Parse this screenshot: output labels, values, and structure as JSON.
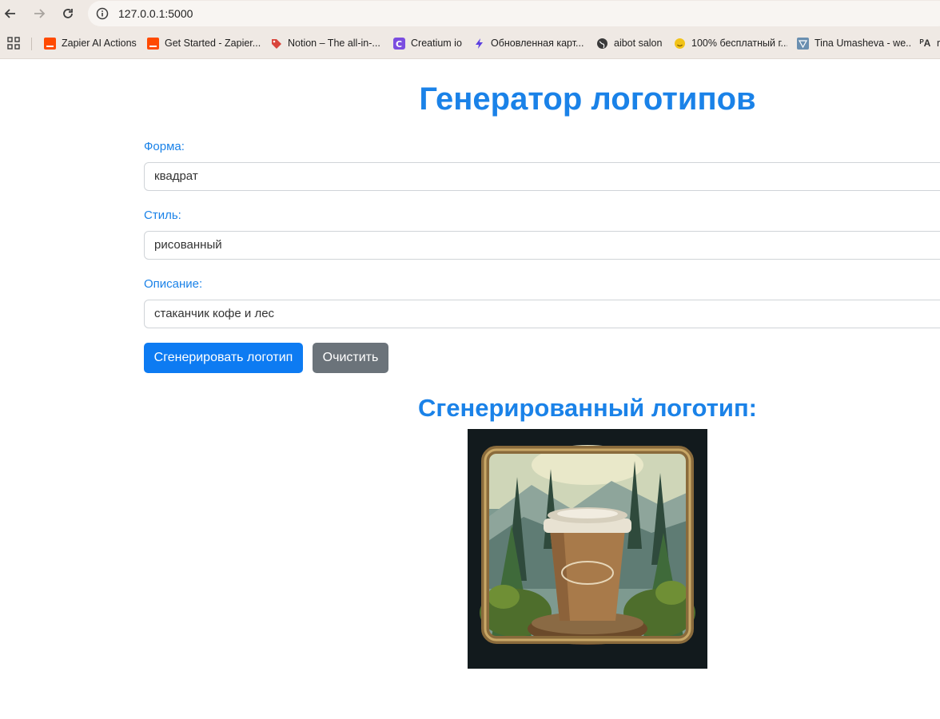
{
  "browser": {
    "url": "127.0.0.1:5000",
    "bookmarks": [
      {
        "label": "Zapier AI Actions",
        "icon": "zapier-icon",
        "color": "#ff4a00"
      },
      {
        "label": "Get Started - Zapier...",
        "icon": "zapier-icon",
        "color": "#ff4a00"
      },
      {
        "label": "Notion – The all-in-...",
        "icon": "tag-icon",
        "color": "#d9453b"
      },
      {
        "label": "Creatium io",
        "icon": "creatium-icon",
        "color": "#7b4de0"
      },
      {
        "label": "Обновленная карт...",
        "icon": "bolt-icon",
        "color": "#5b3fe0"
      },
      {
        "label": "aibot salon",
        "icon": "globe-icon",
        "color": "#3a3a3a"
      },
      {
        "label": "100% бесплатный г...",
        "icon": "smile-icon",
        "color": "#f2c318"
      },
      {
        "label": "Tina Umasheva - we...",
        "icon": "triangle-icon",
        "color": "#6a8fb0"
      },
      {
        "label": "r",
        "icon": "translate-icon",
        "color": "#333333"
      }
    ]
  },
  "page": {
    "title": "Генератор логотипов",
    "form": {
      "shape_label": "Форма:",
      "shape_value": "квадрат",
      "style_label": "Стиль:",
      "style_value": "рисованный",
      "description_label": "Описание:",
      "description_value": "стаканчик кофе и лес"
    },
    "buttons": {
      "generate": "Сгенерировать логотип",
      "clear": "Очистить"
    },
    "result_title": "Сгенерированный логотип:"
  },
  "colors": {
    "accent": "#1a82e8",
    "primary_button": "#0d7bf2",
    "secondary_button": "#6b737a"
  }
}
